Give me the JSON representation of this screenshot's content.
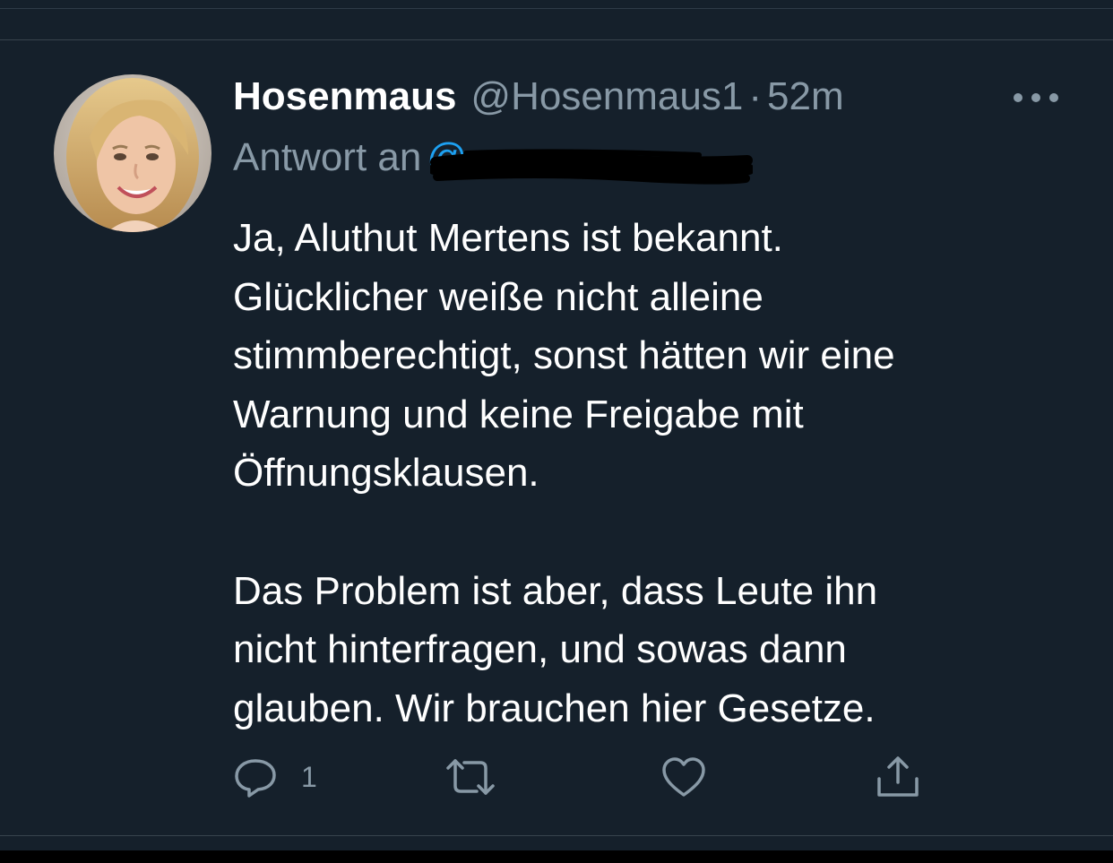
{
  "tweet": {
    "display_name": "Hosenmaus",
    "handle": "@Hosenmaus1",
    "separator": "·",
    "time": "52m",
    "reply_prefix": "Antwort an",
    "reply_mention": "@",
    "text": "Ja, Aluthut Mertens ist bekannt.\nGlücklicher weiße nicht alleine\nstimmberechtigt, sonst hätten wir eine\nWarnung und keine Freigabe mit\nÖffnungsklausen.\n\nDas Problem ist aber, dass Leute ihn\nnicht hinterfragen, und sowas dann\nglauben. Wir brauchen hier Gesetze.",
    "actions": {
      "reply_count": "1",
      "retweet_count": "",
      "like_count": ""
    }
  },
  "colors": {
    "background": "#15202b",
    "secondary_text": "#8899a6",
    "accent": "#1da1f2",
    "divider": "#38444d"
  },
  "icons": {
    "reply": "speech-bubble-icon",
    "retweet": "retweet-icon",
    "like": "heart-icon",
    "share": "share-icon",
    "more": "ellipsis-icon"
  }
}
